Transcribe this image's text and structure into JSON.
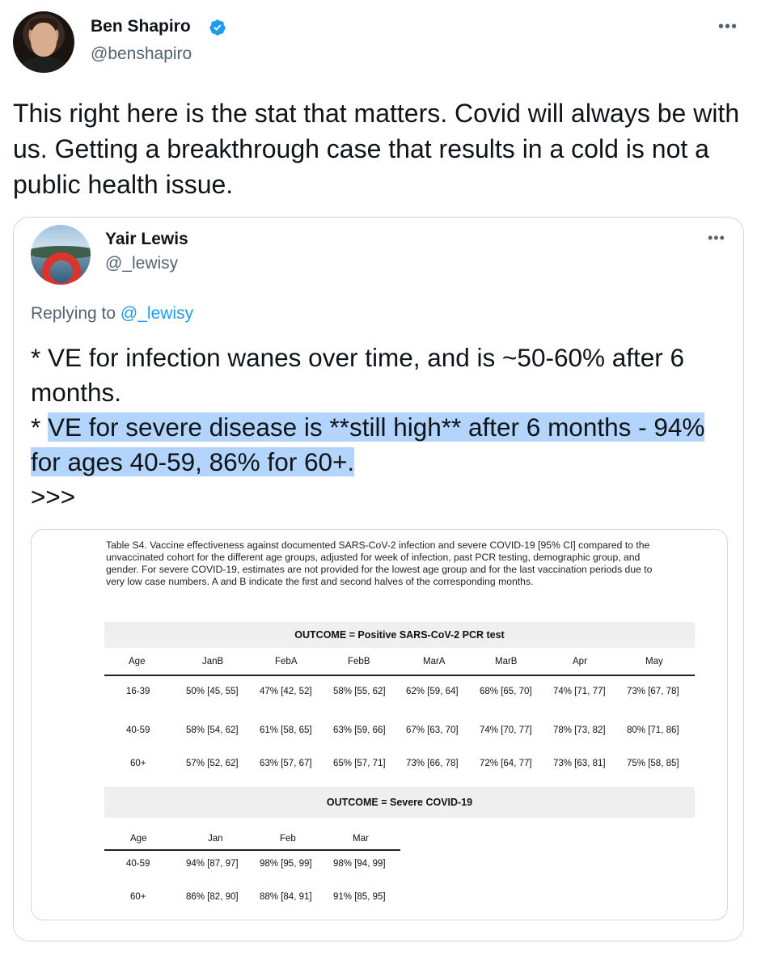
{
  "tweet": {
    "author_name": "Ben Shapiro",
    "author_handle": "@benshapiro",
    "text": "This right here is the stat that matters. Covid will always be with us. Getting a breakthrough case that results in a cold is not a public health issue."
  },
  "quoted": {
    "author_name": "Yair Lewis",
    "author_handle": "@_lewisy",
    "replying_prefix": "Replying to ",
    "replying_to": "@_lewisy",
    "text_part1": "* VE for infection wanes over time, and is ~50-60% after 6 months.",
    "text_part2_prefix": "* ",
    "text_part2_highlight": "VE for severe disease is **still high** after 6 months - 94% for ages 40-59, 86% for 60+.",
    "text_part3": ">>>"
  },
  "table_image": {
    "caption": "Table S4. Vaccine effectiveness against documented SARS-CoV-2 infection and severe COVID-19 [95% CI] compared to the unvaccinated cohort for the different age groups, adjusted for week of infection, past PCR testing, demographic group, and gender. For severe COVID-19, estimates are not provided for the lowest age group and for the last vaccination periods due to very low case numbers. A and B indicate the first and second halves of the corresponding months.",
    "infection": {
      "title": "OUTCOME = Positive SARS-CoV-2 PCR test",
      "headers": [
        "Age",
        "JanB",
        "FebA",
        "FebB",
        "MarA",
        "MarB",
        "Apr",
        "May"
      ],
      "rows": [
        [
          "16-39",
          "50% [45, 55]",
          "47% [42, 52]",
          "58% [55, 62]",
          "62% [59, 64]",
          "68% [65, 70]",
          "74% [71, 77]",
          "73% [67, 78]"
        ],
        [
          "40-59",
          "58% [54, 62]",
          "61% [58, 65]",
          "63% [59, 66]",
          "67% [63, 70]",
          "74% [70, 77]",
          "78% [73, 82]",
          "80% [71, 86]"
        ],
        [
          "60+",
          "57% [52, 62]",
          "63% [57, 67]",
          "65% [57, 71]",
          "73% [66, 78]",
          "72% [64, 77]",
          "73% [63, 81]",
          "75% [58, 85]"
        ]
      ]
    },
    "severe": {
      "title": "OUTCOME = Severe COVID-19",
      "headers": [
        "Age",
        "Jan",
        "Feb",
        "Mar"
      ],
      "rows": [
        [
          "40-59",
          "94% [87, 97]",
          "98% [95, 99]",
          "98% [94, 99]"
        ],
        [
          "60+",
          "86% [82, 90]",
          "88% [84, 91]",
          "91% [85, 95]"
        ]
      ]
    }
  }
}
